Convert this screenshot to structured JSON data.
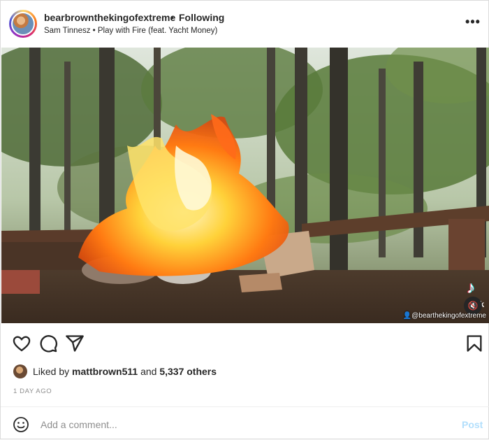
{
  "header": {
    "username": "bearbrownthekingofextreme",
    "separator": "•",
    "follow_status": "Following",
    "audio": "Sam Tinnesz • Play with Fire (feat. Yacht Money)",
    "more_label": "•••"
  },
  "media": {
    "description_icon": "tiktok-logo",
    "tiktok_glyph": "♪",
    "tiktok_word": "T   k",
    "mute_glyph": "🔇",
    "watermark": "👤@bearthekingofextreme"
  },
  "actions": {
    "icons": [
      "heart-icon",
      "comment-icon",
      "share-icon",
      "bookmark-icon"
    ]
  },
  "likes": {
    "prefix": "Liked by ",
    "user": "mattbrown511",
    "middle": " and ",
    "others": "5,337 others"
  },
  "timestamp": "1 DAY AGO",
  "comment": {
    "placeholder": "Add a comment...",
    "post_label": "Post"
  },
  "colors": {
    "link_disabled": "#b2dffc",
    "secondary_text": "#8e8e8e",
    "primary_text": "#262626"
  }
}
